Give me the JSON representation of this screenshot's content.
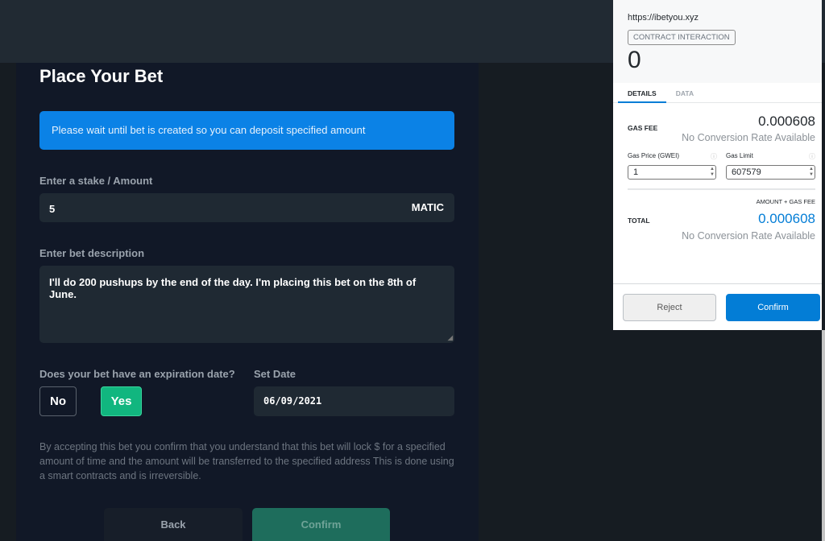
{
  "form": {
    "title": "Place Your Bet",
    "alert": "Please wait until bet is created so you can deposit specified amount",
    "stake_label": "Enter a stake / Amount",
    "stake_value": "5",
    "currency": "MATIC",
    "desc_label": "Enter bet description",
    "desc_value": "I'll do 200 pushups by the end of the day. I'm placing this bet on the 8th of June.",
    "expiration_label": "Does your bet have an expiration date?",
    "no_label": "No",
    "yes_label": "Yes",
    "date_label": "Set Date",
    "date_value": "06/09/2021",
    "note": "By accepting this bet you confirm that you understand that this bet will lock $ for a specified amount of time and the amount will be transferred to the specified address This is done using a smart contracts and is irreversible.",
    "back_label": "Back",
    "confirm_label": "Confirm"
  },
  "wallet": {
    "url": "https://ibetyou.xyz",
    "badge": "CONTRACT INTERACTION",
    "amount": "0",
    "tabs": [
      "DETAILS",
      "DATA"
    ],
    "gas_fee_label": "GAS FEE",
    "gas_fee": "0.000608",
    "no_rate": "No Conversion Rate Available",
    "gas_price_label": "Gas Price (GWEI)",
    "gas_price": "1",
    "gas_limit_label": "Gas Limit",
    "gas_limit": "607579",
    "amount_gas_label": "AMOUNT + GAS FEE",
    "total_label": "TOTAL",
    "total": "0.000608",
    "total_no_rate": "No Conversion Rate Available",
    "reject_label": "Reject",
    "confirm_label": "Confirm",
    "accent": "#037dd6"
  }
}
